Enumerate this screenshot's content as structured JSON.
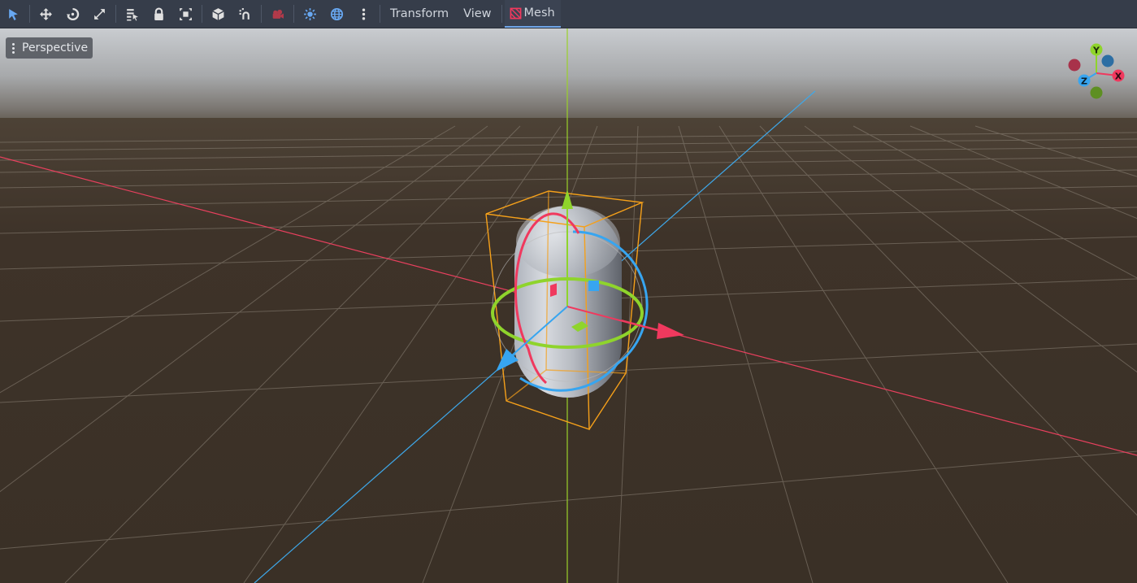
{
  "toolbar": {
    "tools": [
      {
        "name": "select-tool",
        "icon": "select-arrow-icon"
      },
      {
        "name": "move-tool",
        "icon": "move-icon"
      },
      {
        "name": "rotate-tool",
        "icon": "rotate-icon"
      },
      {
        "name": "scale-tool",
        "icon": "scale-icon"
      },
      {
        "name": "list-select-tool",
        "icon": "list-select-icon"
      },
      {
        "name": "lock-tool",
        "icon": "lock-icon"
      },
      {
        "name": "group-tool",
        "icon": "group-icon"
      },
      {
        "name": "local-space-tool",
        "icon": "cube-icon"
      },
      {
        "name": "snap-tool",
        "icon": "snap-magnet-icon"
      },
      {
        "name": "camera-preview-tool",
        "icon": "camera-icon"
      },
      {
        "name": "sun-toggle",
        "icon": "sun-icon"
      },
      {
        "name": "environment-toggle",
        "icon": "globe-icon"
      },
      {
        "name": "more-options",
        "icon": "vertical-dots-icon"
      }
    ],
    "menus": {
      "transform": "Transform",
      "view": "View",
      "mesh": "Mesh"
    },
    "active_menu": "Mesh"
  },
  "viewport": {
    "view_menu_label": "Perspective",
    "axis_gizmo": {
      "x_label": "X",
      "y_label": "Y",
      "z_label": "Z"
    }
  },
  "colors": {
    "toolbar_bg": "#363d4a",
    "accent_blue": "#70a6e8",
    "axis_x": "#f0395e",
    "axis_y": "#8fd42c",
    "axis_z": "#37a5f0",
    "selection_box": "#f5a01a",
    "ground": "#3b3127"
  }
}
